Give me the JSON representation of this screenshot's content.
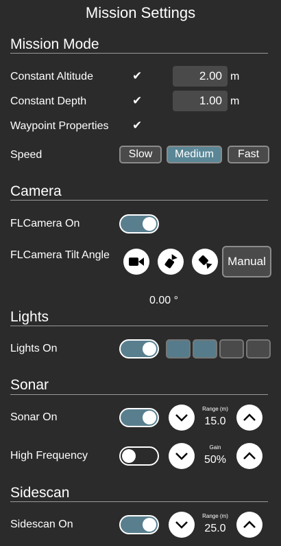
{
  "title": "Mission Settings",
  "mission_mode": {
    "header": "Mission Mode",
    "constant_altitude": {
      "label": "Constant Altitude",
      "check": "✔",
      "value": "2.00",
      "unit": "m"
    },
    "constant_depth": {
      "label": "Constant Depth",
      "check": "✔",
      "value": "1.00",
      "unit": "m"
    },
    "waypoint_properties": {
      "label": "Waypoint Properties",
      "check": "✔"
    },
    "speed": {
      "label": "Speed",
      "options": [
        "Slow",
        "Medium",
        "Fast"
      ],
      "selected": "Medium"
    }
  },
  "camera": {
    "header": "Camera",
    "fl_on": {
      "label": "FLCamera On",
      "state": "on"
    },
    "tilt": {
      "label": "FLCamera Tilt Angle",
      "manual": "Manual",
      "angle": "0.00 °"
    }
  },
  "lights": {
    "header": "Lights",
    "lights_on": {
      "label": "Lights On",
      "state": "on"
    },
    "level_segments": [
      "on",
      "on",
      "off",
      "off"
    ]
  },
  "sonar": {
    "header": "Sonar",
    "sonar_on": {
      "label": "Sonar On",
      "state": "on",
      "caption": "Range (m)",
      "value": "15.0"
    },
    "high_freq": {
      "label": "High Frequency",
      "state": "off",
      "caption": "Gain",
      "value": "50%"
    }
  },
  "sidescan": {
    "header": "Sidescan",
    "sidescan_on": {
      "label": "Sidescan On",
      "state": "on",
      "caption": "Range (m)",
      "value": "25.0"
    }
  },
  "colors": {
    "background": "#2b2b2b",
    "accent": "#5a8696",
    "box": "#4a4a4a"
  }
}
